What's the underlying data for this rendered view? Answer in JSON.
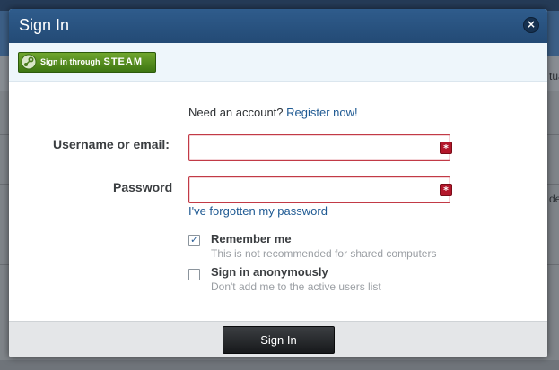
{
  "background": {
    "right_text_1": "tua",
    "right_text_2": "de"
  },
  "dialog": {
    "title": "Sign In",
    "close_label": "×",
    "steam_button": {
      "prefix": "Sign in through",
      "brand": "STEAM"
    },
    "need_account_text": "Need an account?",
    "register_link": "Register now!",
    "username_label": "Username or email:",
    "username_value": "",
    "password_label": "Password",
    "password_value": "",
    "required_marker": "*",
    "forgot_link": "I've forgotten my password",
    "remember_me": {
      "label": "Remember me",
      "hint": "This is not recommended for shared computers",
      "checked": true
    },
    "anonymous": {
      "label": "Sign in anonymously",
      "hint": "Don't add me to the active users list",
      "checked": false
    },
    "submit_label": "Sign In"
  },
  "colors": {
    "header": "#2f5c8c",
    "link": "#1f5a93",
    "error_border": "#c23a46",
    "steam_green": "#5a9322"
  }
}
